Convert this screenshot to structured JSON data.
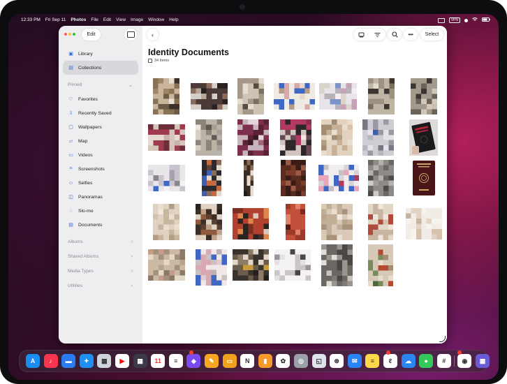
{
  "menubar": {
    "time": "12:33 PM",
    "date": "Fri Sep 11",
    "app": "Photos",
    "menus": [
      "File",
      "Edit",
      "View",
      "Image",
      "Window",
      "Help"
    ],
    "status_badge": "VPN"
  },
  "toolbar": {
    "edit_label": "Edit",
    "select_label": "Select"
  },
  "sidebar": {
    "items": [
      {
        "label": "Library",
        "icon": "photo-library-icon"
      },
      {
        "label": "Collections",
        "icon": "collections-icon",
        "selected": true
      }
    ],
    "pinned_header": "Pinned",
    "pinned": [
      {
        "label": "Favorites",
        "icon": "heart-icon"
      },
      {
        "label": "Recently Saved",
        "icon": "download-icon"
      },
      {
        "label": "Wallpapers",
        "icon": "wallpaper-icon"
      },
      {
        "label": "Map",
        "icon": "map-icon"
      },
      {
        "label": "Videos",
        "icon": "video-icon"
      },
      {
        "label": "Screenshots",
        "icon": "screenshot-icon"
      },
      {
        "label": "Selfies",
        "icon": "selfie-icon"
      },
      {
        "label": "Panoramas",
        "icon": "panorama-icon"
      },
      {
        "label": "Slo-mo",
        "icon": "slomo-icon"
      },
      {
        "label": "Documents",
        "icon": "document-icon"
      }
    ],
    "sections": [
      "Albums",
      "Shared Albums",
      "Media Types",
      "Utilities"
    ]
  },
  "main": {
    "title": "Identity Documents",
    "count": "34 Items"
  },
  "colors": {
    "accent": "#2f6bd9",
    "sidebar_bg": "#eeedf0",
    "selected_bg": "#d8d7dc"
  },
  "thumbnails": [
    {
      "seed": 1,
      "palette": [
        "#c9b59b",
        "#8a7355",
        "#3c3028",
        "#e8e0d2",
        "#6d5a47",
        "#a08466"
      ]
    },
    {
      "seed": 2,
      "palette": [
        "#4a3b36",
        "#d6cfc7",
        "#8c6b5d",
        "#2a2220",
        "#b8a89a",
        "#efe9e3"
      ]
    },
    {
      "seed": 3,
      "palette": [
        "#cfc3b3",
        "#a59888",
        "#7b6f62",
        "#e5ddd2",
        "#574c42",
        "#bcae9c"
      ]
    },
    {
      "seed": 4,
      "palette": [
        "#f0eae4",
        "#d8a9a6",
        "#3f68c4",
        "#b79c87",
        "#e7d8c9",
        "#c7b29d"
      ]
    },
    {
      "seed": 5,
      "palette": [
        "#e9e4ea",
        "#7a93c9",
        "#c5a2b5",
        "#dcd3cb",
        "#b8b3b8",
        "#f3eff2"
      ]
    },
    {
      "seed": 6,
      "palette": [
        "#bfb5a5",
        "#9d9282",
        "#3b3632",
        "#d8cfc2",
        "#77705f",
        "#e4dccd"
      ]
    },
    {
      "seed": 7,
      "palette": [
        "#a39a8e",
        "#6b6258",
        "#d2c7b9",
        "#3b3631",
        "#c9c0b2",
        "#5a6a9c"
      ]
    },
    {
      "seed": 8,
      "palette": [
        "#a03a4f",
        "#d4c6bb",
        "#6d2d3b",
        "#e4dbd2",
        "#8a5e6a",
        "#c9b2a9"
      ]
    },
    {
      "seed": 9,
      "palette": [
        "#bab3a8",
        "#8b847a",
        "#d7d0c5",
        "#605952",
        "#ece6dc",
        "#a8a096"
      ]
    },
    {
      "seed": 10,
      "palette": [
        "#7e2f4d",
        "#c8b4bc",
        "#5a2233",
        "#e2d6dc",
        "#a4667e",
        "#3c1a25"
      ]
    },
    {
      "seed": 11,
      "palette": [
        "#2d2728",
        "#b03a62",
        "#d2c4be",
        "#6a4a52",
        "#efe5e1",
        "#8c2f4a"
      ]
    },
    {
      "seed": 12,
      "palette": [
        "#e2d3c0",
        "#c8b196",
        "#b39d83",
        "#eadfce",
        "#a38c74",
        "#d6c4ab"
      ]
    },
    {
      "seed": 13,
      "palette": [
        "#cfccd4",
        "#9d99a3",
        "#e5e3e8",
        "#7b7782",
        "#b9b5bd",
        "#3e5fa8"
      ]
    },
    {
      "seed": 14,
      "type": "passport-black"
    },
    {
      "seed": 15,
      "palette": [
        "#e9e6ea",
        "#c8c3cc",
        "#3f68c4",
        "#a8a2ad",
        "#f5f2f5",
        "#8a8390"
      ]
    },
    {
      "seed": 16,
      "palette": [
        "#2b2a2e",
        "#c66a44",
        "#3a5fb6",
        "#8b6b58",
        "#e3d8cc",
        "#5a4336"
      ]
    },
    {
      "seed": 17,
      "palette": [
        "#3b2b22",
        "#e7dfd5",
        "#8c6c55",
        "#1f1a17",
        "#c9b8a6",
        "#6b5240"
      ]
    },
    {
      "seed": 18,
      "palette": [
        "#5a2b1f",
        "#3a1c16",
        "#7b3d2a",
        "#9a5a44",
        "#2a1510",
        "#c28f75"
      ]
    },
    {
      "seed": 19,
      "palette": [
        "#f1edef",
        "#e7a7b9",
        "#3f68c4",
        "#d8d3d7",
        "#c7c1c6",
        "#b23b5a"
      ]
    },
    {
      "seed": 20,
      "palette": [
        "#8e8a86",
        "#6b6763",
        "#b5b1ac",
        "#4d4a47",
        "#cfcac5",
        "#a39e99"
      ]
    },
    {
      "seed": 21,
      "type": "passport-red"
    },
    {
      "seed": 22,
      "palette": [
        "#dfd2c1",
        "#c8b59e",
        "#e9ded0",
        "#b29c84",
        "#d4c2ac",
        "#f0e7dc"
      ]
    },
    {
      "seed": 23,
      "palette": [
        "#3a2e27",
        "#8e5a3e",
        "#e0d3c6",
        "#5b4134",
        "#c0a189",
        "#2a211c"
      ]
    },
    {
      "seed": 24,
      "palette": [
        "#b3412f",
        "#2b2320",
        "#e1864a",
        "#7b3022",
        "#d9c9bb",
        "#4a2f28"
      ]
    },
    {
      "seed": 25,
      "palette": [
        "#c2503a",
        "#9b3a2a",
        "#e0826a",
        "#7a2a1e",
        "#d8b4a4",
        "#5a1e16"
      ]
    },
    {
      "seed": 26,
      "palette": [
        "#d9cab8",
        "#c2ae97",
        "#e9dfd2",
        "#a9937b",
        "#b9a48c",
        "#f1e9de"
      ]
    },
    {
      "seed": 27,
      "palette": [
        "#e2d6c7",
        "#c9b6a0",
        "#b04a3c",
        "#efe7dd",
        "#d3c2ae",
        "#9e8a76"
      ]
    },
    {
      "seed": 28,
      "palette": [
        "#f2ece6",
        "#e3d3c4",
        "#d5c1ac",
        "#f7f3ef",
        "#c8b39e",
        "#ebe0d5"
      ]
    },
    {
      "seed": 29,
      "palette": [
        "#cbb9a3",
        "#a4917b",
        "#e4d8c9",
        "#8b7a67",
        "#c69c8a",
        "#b8a48d"
      ]
    },
    {
      "seed": 30,
      "palette": [
        "#efe8e6",
        "#d8a9b2",
        "#3f68c4",
        "#c9c2c1",
        "#e2cbd0",
        "#b9b2b4"
      ]
    },
    {
      "seed": 31,
      "palette": [
        "#3a322c",
        "#6c5c4b",
        "#e1d7cb",
        "#8f7c66",
        "#c89b3c",
        "#252020"
      ]
    },
    {
      "seed": 32,
      "palette": [
        "#f4f2f2",
        "#c9c5c8",
        "#4a4548",
        "#e4e1e3",
        "#9a9598",
        "#2c2a2d"
      ]
    },
    {
      "seed": 33,
      "palette": [
        "#6b6763",
        "#9a958f",
        "#c8c3bd",
        "#4a4744",
        "#e2ddd7",
        "#807b76"
      ]
    },
    {
      "seed": 34,
      "palette": [
        "#d7c9b8",
        "#7a8c5b",
        "#b3492f",
        "#e8dccd",
        "#a68d6f",
        "#4e6a3a"
      ]
    }
  ],
  "dock": {
    "apps": [
      {
        "name": "app-store",
        "color": "#1b8cf2",
        "glyph": "A"
      },
      {
        "name": "music",
        "color": "#f8344f",
        "glyph": "♪"
      },
      {
        "name": "files",
        "color": "#2b7cf0",
        "glyph": "▬"
      },
      {
        "name": "safari",
        "color": "#1f8ff0",
        "glyph": "✦"
      },
      {
        "name": "launchpad",
        "color": "#cfd3db",
        "glyph": "▦"
      },
      {
        "name": "youtube",
        "color": "#ffffff",
        "glyph": "▶"
      },
      {
        "name": "shortcuts-grid",
        "color": "#3a3a4a",
        "glyph": "▦"
      },
      {
        "name": "calendar",
        "color": "#ffffff",
        "glyph": "11"
      },
      {
        "name": "reminders",
        "color": "#ffffff",
        "glyph": "≡"
      },
      {
        "name": "shortcuts",
        "color": "#7a4af0",
        "glyph": "◆"
      },
      {
        "name": "pages",
        "color": "#f6a623",
        "glyph": "✎"
      },
      {
        "name": "keynote",
        "color": "#f0a21e",
        "glyph": "▭"
      },
      {
        "name": "notion",
        "color": "#ffffff",
        "glyph": "N"
      },
      {
        "name": "books",
        "color": "#f59a2b",
        "glyph": "▮"
      },
      {
        "name": "photos",
        "color": "#ffffff",
        "glyph": "✿"
      },
      {
        "name": "camera",
        "color": "#9aa0a8",
        "glyph": "◎"
      },
      {
        "name": "preview",
        "color": "#dfe3ea",
        "glyph": "◱"
      },
      {
        "name": "chatgpt",
        "color": "#ffffff",
        "glyph": "⊛"
      },
      {
        "name": "mail",
        "color": "#2a84f3",
        "glyph": "✉"
      },
      {
        "name": "notes",
        "color": "#ffd84a",
        "glyph": "≡"
      },
      {
        "name": "freeform",
        "color": "#ffffff",
        "glyph": "ℓ"
      },
      {
        "name": "icloud",
        "color": "#2b86f0",
        "glyph": "☁"
      },
      {
        "name": "messages",
        "color": "#34c759",
        "glyph": "●"
      },
      {
        "name": "slack",
        "color": "#ffffff",
        "glyph": "#"
      },
      {
        "name": "reeder",
        "color": "#ffffff",
        "glyph": "◉"
      },
      {
        "name": "setapp",
        "color": "#6b5cd6",
        "glyph": "▦"
      }
    ]
  }
}
